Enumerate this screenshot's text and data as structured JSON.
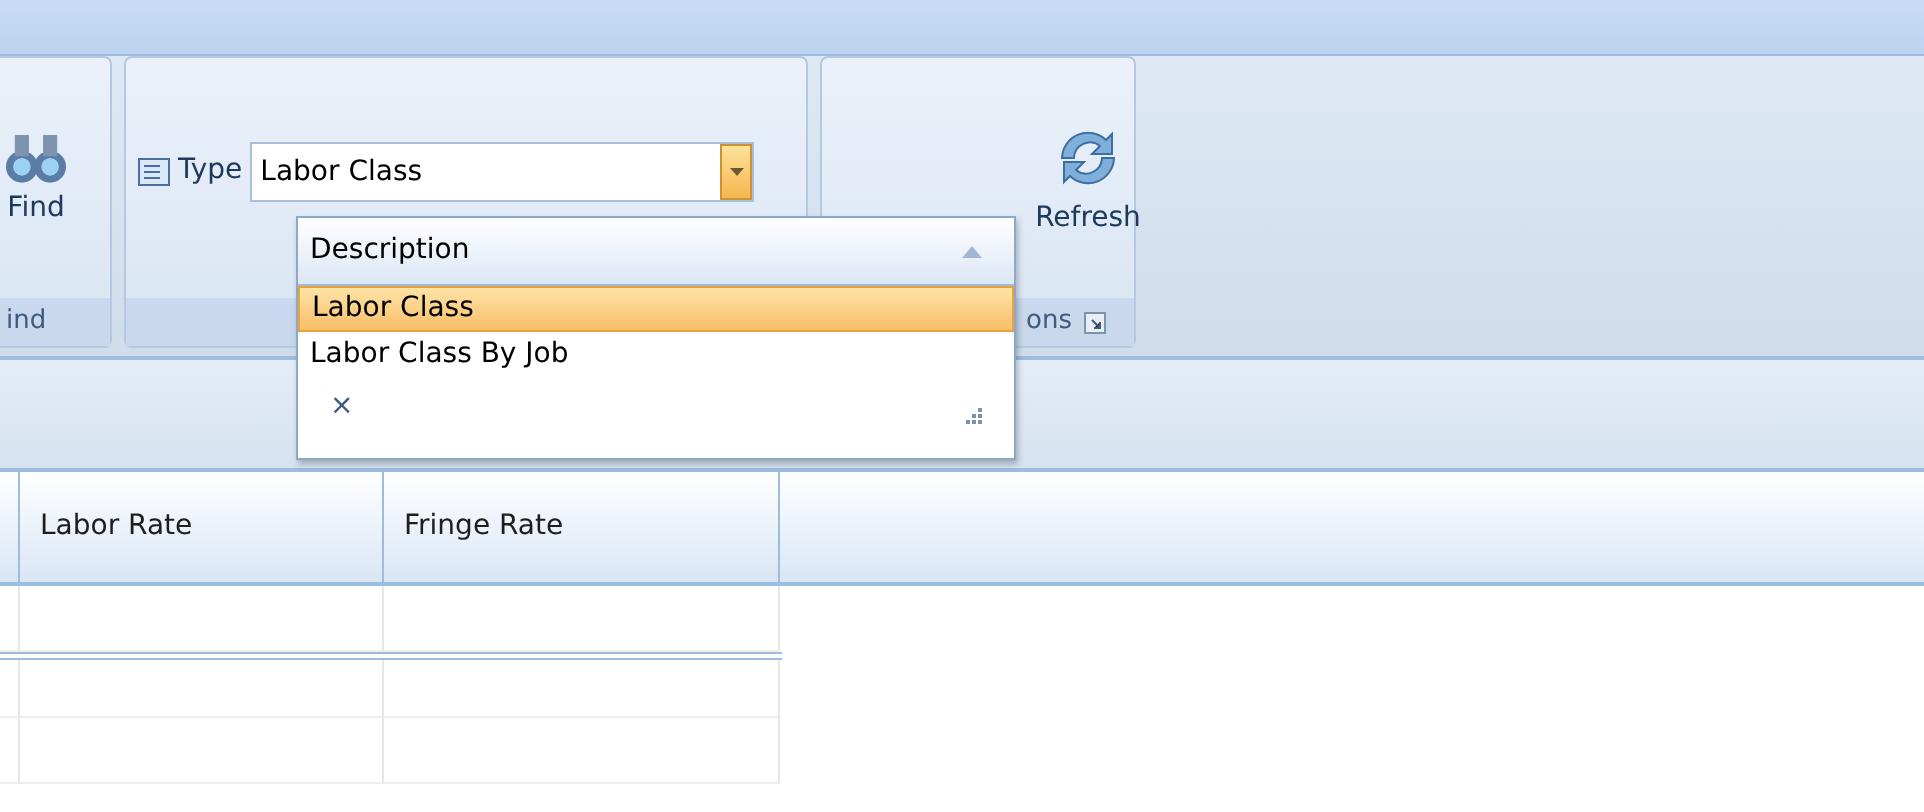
{
  "ribbon": {
    "groups": [
      {
        "kind": "find",
        "button": "Find",
        "label": "ind"
      },
      {
        "kind": "type",
        "field_label": "Type",
        "value": "Labor Class"
      },
      {
        "kind": "refresh",
        "button": "Refresh",
        "label": "ons"
      }
    ]
  },
  "dropdown": {
    "expanded": true,
    "column": "Description",
    "items": [
      {
        "label": "Labor Class",
        "selected": true
      },
      {
        "label": "Labor Class By Job",
        "selected": false
      }
    ],
    "clear": "×"
  },
  "grid": {
    "columns": [
      "Labor Rate",
      "Fringe Rate"
    ]
  }
}
